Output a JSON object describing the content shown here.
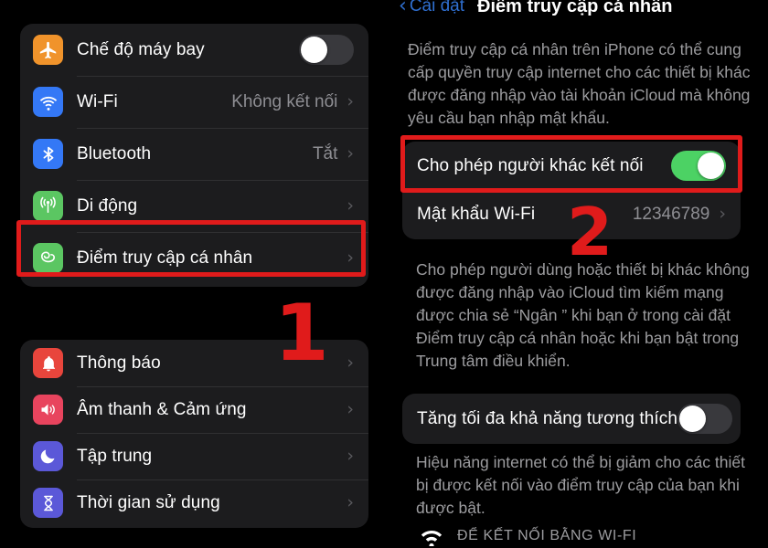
{
  "screen": {
    "background": "#000000",
    "card_background": "#1c1c1e",
    "accent_blue": "#2f6fd0",
    "toggle_on_color": "#4cd264",
    "toggle_off_color": "#39393d",
    "annotation_color": "#e01b1b"
  },
  "left_pane": {
    "card1": {
      "rows": [
        {
          "label": "Chế độ máy bay",
          "icon": "airplane-icon",
          "icon_color": "#f0932b",
          "control": "toggle",
          "toggle_state": "off",
          "value": "",
          "chevron": false
        },
        {
          "label": "Wi-Fi",
          "icon": "wifi-icon",
          "icon_color": "#3478f6",
          "control": "value",
          "value": "Không kết nối",
          "chevron": true
        },
        {
          "label": "Bluetooth",
          "icon": "bluetooth-icon",
          "icon_color": "#3478f6",
          "control": "value",
          "value": "Tắt",
          "chevron": true
        },
        {
          "label": "Di động",
          "icon": "cellular-antenna-icon",
          "icon_color": "#5bc662",
          "control": "chevron",
          "value": "",
          "chevron": true
        },
        {
          "label": "Điểm truy cập cá nhân",
          "icon": "personal-hotspot-icon",
          "icon_color": "#5bc662",
          "control": "chevron",
          "value": "",
          "chevron": true
        }
      ]
    },
    "card2": {
      "rows": [
        {
          "label": "Thông báo",
          "icon": "bell-icon",
          "icon_color": "#e8453c",
          "control": "chevron",
          "value": "",
          "chevron": true
        },
        {
          "label": "Âm thanh & Cảm ứng",
          "icon": "speaker-icon",
          "icon_color": "#e8445e",
          "control": "chevron",
          "value": "",
          "chevron": true
        },
        {
          "label": "Tập trung",
          "icon": "moon-icon",
          "icon_color": "#5b58d8",
          "control": "chevron",
          "value": "",
          "chevron": true
        },
        {
          "label": "Thời gian sử dụng",
          "icon": "hourglass-icon",
          "icon_color": "#5b58d8",
          "control": "chevron",
          "value": "",
          "chevron": true
        }
      ]
    }
  },
  "right_pane": {
    "nav": {
      "back_label": "Cài đặt",
      "title": "Điểm truy cập cá nhân"
    },
    "intro_text": "Điểm truy cập cá nhân trên iPhone có thể cung cấp quyền truy cập internet cho các thiết bị khác được đăng nhập vào tài khoản iCloud mà không yêu cầu bạn nhập mật khẩu.",
    "hotspot_card": {
      "rows": [
        {
          "label": "Cho phép người khác kết nối",
          "control": "toggle",
          "toggle_state": "on",
          "value": "",
          "chevron": false
        },
        {
          "label": "Mật khẩu Wi-Fi",
          "control": "value",
          "value": "12346789",
          "chevron": true
        }
      ]
    },
    "hotspot_footnote": "Cho phép người dùng hoặc thiết bị khác không được đăng nhập vào iCloud tìm kiếm mạng được chia sẻ “Ngân ” khi bạn ở trong cài đặt Điểm truy cập cá nhân hoặc khi bạn bật trong Trung tâm điều khiển.",
    "compat_card": {
      "rows": [
        {
          "label": "Tăng tối đa khả năng tương thích",
          "control": "toggle",
          "toggle_state": "off",
          "value": "",
          "chevron": false
        }
      ]
    },
    "compat_footnote": "Hiệu năng internet có thể bị giảm cho các thiết bị được kết nối vào điểm truy cập của bạn khi được bật.",
    "wifi_section_header": {
      "icon": "wifi-icon",
      "label": "ĐỂ KẾT NỐI BẰNG WI-FI"
    }
  },
  "annotations": {
    "step1": {
      "number": "1",
      "target": "personal-hotspot-row"
    },
    "step2": {
      "number": "2",
      "target": "allow-others-to-join-row"
    }
  }
}
